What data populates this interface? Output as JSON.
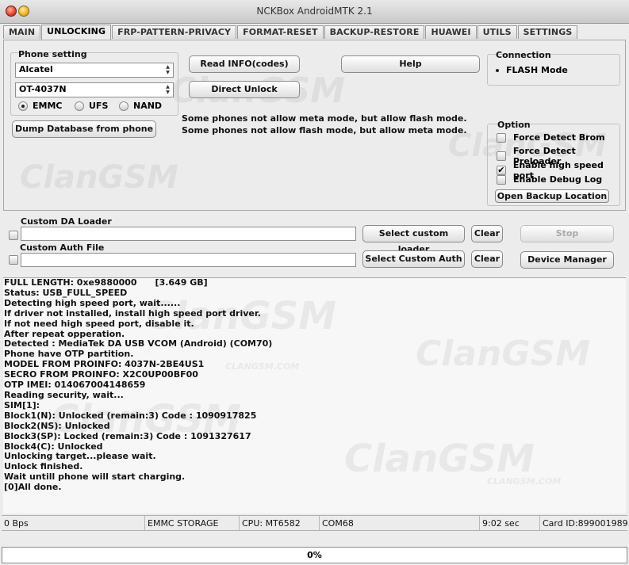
{
  "window": {
    "title": "NCKBox AndroidMTK 2.1"
  },
  "tabs": [
    "MAIN",
    "UNLOCKING",
    "FRP-PATTERN-PRIVACY",
    "FORMAT-RESET",
    "BACKUP-RESTORE",
    "HUAWEI",
    "UTILS",
    "SETTINGS"
  ],
  "active_tab": "UNLOCKING",
  "phone_setting": {
    "label": "Phone setting",
    "brand": "Alcatel",
    "model": "OT-4037N",
    "storage_options": [
      "EMMC",
      "UFS",
      "NAND"
    ],
    "storage_selected": "EMMC",
    "dump_button": "Dump Database from phone"
  },
  "actions": {
    "read_info": "Read INFO(codes)",
    "direct_unlock": "Direct Unlock",
    "help": "Help"
  },
  "notes": [
    "Some phones not allow meta mode, but allow flash mode.",
    "Some phones not allow flash mode, but allow meta mode."
  ],
  "connection": {
    "label": "Connection",
    "mode": "FLASH Mode"
  },
  "option": {
    "label": "Option",
    "items": [
      {
        "label": "Force Detect Brom",
        "checked": false
      },
      {
        "label": "Force Detect Preloader",
        "checked": false
      },
      {
        "label": "Enable high speed port",
        "checked": true
      },
      {
        "label": "Enable Debug Log",
        "checked": false
      }
    ],
    "open_backup": "Open Backup Location"
  },
  "loaders": {
    "da_label": "Custom DA Loader",
    "auth_label": "Custom Auth File",
    "select_da": "Select custom loader",
    "select_auth": "Select Custom Auth",
    "clear": "Clear",
    "stop": "Stop",
    "device_manager": "Device Manager"
  },
  "log": [
    "FULL LENGTH: 0xe9880000      [3.649 GB]",
    "Status: USB_FULL_SPEED",
    "Detecting high speed port, wait......",
    "If driver not installed, install high speed port driver.",
    "If not need high speed port, disable it.",
    "After repeat opperation.",
    "Detected : MediaTek DA USB VCOM (Android) (COM70)",
    "Phone have OTP partition.",
    "MODEL FROM PROINFO: 4037N-2BE4US1",
    "SECRO FROM PROINFO: X2C0UP00BF00",
    "OTP IMEI: 014067004148659",
    "Reading security, wait...",
    "SIM[1]:",
    "Block1(N): Unlocked (remain:3) Code : 1090917825",
    "Block2(NS): Unlocked",
    "Block3(SP): Locked (remain:3) Code : 1091327617",
    "Block4(C): Unlocked",
    "Unlocking target...please wait.",
    "Unlock finished.",
    "Wait untill phone will start charging.",
    "[0]All done."
  ],
  "status": {
    "speed": "0 Bps",
    "storage": "EMMC STORAGE",
    "cpu": "CPU: MT6582",
    "port": "COM68",
    "time": "9:02 sec",
    "card_id": "Card ID:899001989"
  },
  "progress": {
    "value": 0,
    "label": "0%"
  },
  "watermark": {
    "text": "ClanGSM",
    "small": "CLANGSM.COM"
  }
}
